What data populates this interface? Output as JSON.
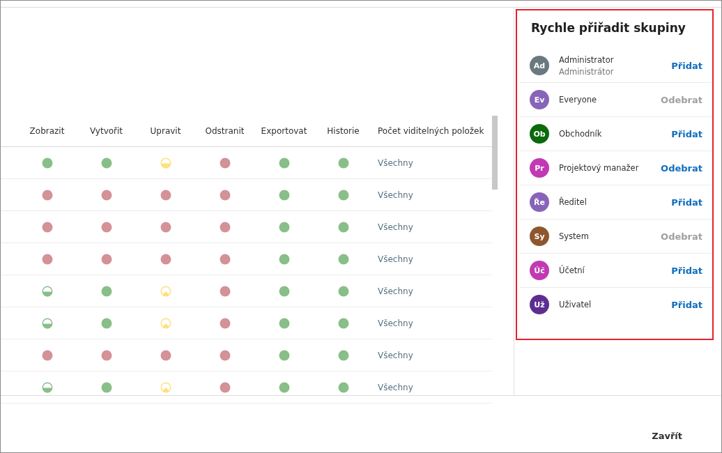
{
  "table": {
    "columns": [
      "Zobrazit",
      "Vytvořit",
      "Upravit",
      "Odstranit",
      "Exportovat",
      "Historie",
      "Počet viditelných položek"
    ],
    "rows": [
      {
        "cells": [
          {
            "kind": "full",
            "color": "#88bf88"
          },
          {
            "kind": "full",
            "color": "#88bf88"
          },
          {
            "kind": "half",
            "color": "#ffe07a"
          },
          {
            "kind": "full",
            "color": "#d39296"
          },
          {
            "kind": "full",
            "color": "#88bf88"
          },
          {
            "kind": "full",
            "color": "#88bf88"
          }
        ],
        "visible": "Všechny"
      },
      {
        "cells": [
          {
            "kind": "full",
            "color": "#d39296"
          },
          {
            "kind": "full",
            "color": "#d39296"
          },
          {
            "kind": "full",
            "color": "#d39296"
          },
          {
            "kind": "full",
            "color": "#d39296"
          },
          {
            "kind": "full",
            "color": "#88bf88"
          },
          {
            "kind": "full",
            "color": "#88bf88"
          }
        ],
        "visible": "Všechny"
      },
      {
        "cells": [
          {
            "kind": "full",
            "color": "#d39296"
          },
          {
            "kind": "full",
            "color": "#d39296"
          },
          {
            "kind": "full",
            "color": "#d39296"
          },
          {
            "kind": "full",
            "color": "#d39296"
          },
          {
            "kind": "full",
            "color": "#88bf88"
          },
          {
            "kind": "full",
            "color": "#88bf88"
          }
        ],
        "visible": "Všechny"
      },
      {
        "cells": [
          {
            "kind": "full",
            "color": "#d39296"
          },
          {
            "kind": "full",
            "color": "#d39296"
          },
          {
            "kind": "full",
            "color": "#d39296"
          },
          {
            "kind": "full",
            "color": "#d39296"
          },
          {
            "kind": "full",
            "color": "#88bf88"
          },
          {
            "kind": "full",
            "color": "#88bf88"
          }
        ],
        "visible": "Všechny"
      },
      {
        "cells": [
          {
            "kind": "half",
            "color": "#88bf88"
          },
          {
            "kind": "full",
            "color": "#88bf88"
          },
          {
            "kind": "peak",
            "color": "#ffe07a"
          },
          {
            "kind": "full",
            "color": "#d39296"
          },
          {
            "kind": "full",
            "color": "#88bf88"
          },
          {
            "kind": "full",
            "color": "#88bf88"
          }
        ],
        "visible": "Všechny"
      },
      {
        "cells": [
          {
            "kind": "half",
            "color": "#88bf88"
          },
          {
            "kind": "full",
            "color": "#88bf88"
          },
          {
            "kind": "peak",
            "color": "#ffe07a"
          },
          {
            "kind": "full",
            "color": "#d39296"
          },
          {
            "kind": "full",
            "color": "#88bf88"
          },
          {
            "kind": "full",
            "color": "#88bf88"
          }
        ],
        "visible": "Všechny"
      },
      {
        "cells": [
          {
            "kind": "full",
            "color": "#d39296"
          },
          {
            "kind": "full",
            "color": "#d39296"
          },
          {
            "kind": "full",
            "color": "#d39296"
          },
          {
            "kind": "full",
            "color": "#d39296"
          },
          {
            "kind": "full",
            "color": "#88bf88"
          },
          {
            "kind": "full",
            "color": "#88bf88"
          }
        ],
        "visible": "Všechny"
      },
      {
        "cells": [
          {
            "kind": "half",
            "color": "#88bf88"
          },
          {
            "kind": "full",
            "color": "#88bf88"
          },
          {
            "kind": "peak",
            "color": "#ffe07a"
          },
          {
            "kind": "full",
            "color": "#d39296"
          },
          {
            "kind": "full",
            "color": "#88bf88"
          },
          {
            "kind": "full",
            "color": "#88bf88"
          }
        ],
        "visible": "Všechny"
      }
    ]
  },
  "panel": {
    "title": "Rychle přiřadit skupiny",
    "groups": [
      {
        "initials": "Ad",
        "color": "#69797e",
        "name": "Administrator",
        "subtitle": "Administrátor",
        "action": "Přidat",
        "disabled": false
      },
      {
        "initials": "Ev",
        "color": "#8764b8",
        "name": "Everyone",
        "action": "Odebrat",
        "disabled": true
      },
      {
        "initials": "Ob",
        "color": "#0b6a0b",
        "name": "Obchodník",
        "action": "Přidat",
        "disabled": false
      },
      {
        "initials": "Pr",
        "color": "#c239b3",
        "name": "Projektový manažer",
        "action": "Odebrat",
        "disabled": false
      },
      {
        "initials": "Ře",
        "color": "#8764b8",
        "name": "Ředitel",
        "action": "Přidat",
        "disabled": false
      },
      {
        "initials": "Sy",
        "color": "#8e562e",
        "name": "System",
        "action": "Odebrat",
        "disabled": true
      },
      {
        "initials": "Úč",
        "color": "#c239b3",
        "name": "Účetní",
        "action": "Přidat",
        "disabled": false
      },
      {
        "initials": "Už",
        "color": "#5c2e91",
        "name": "Uživatel",
        "action": "Přidat",
        "disabled": false
      }
    ]
  },
  "footer": {
    "close": "Zavřít"
  }
}
